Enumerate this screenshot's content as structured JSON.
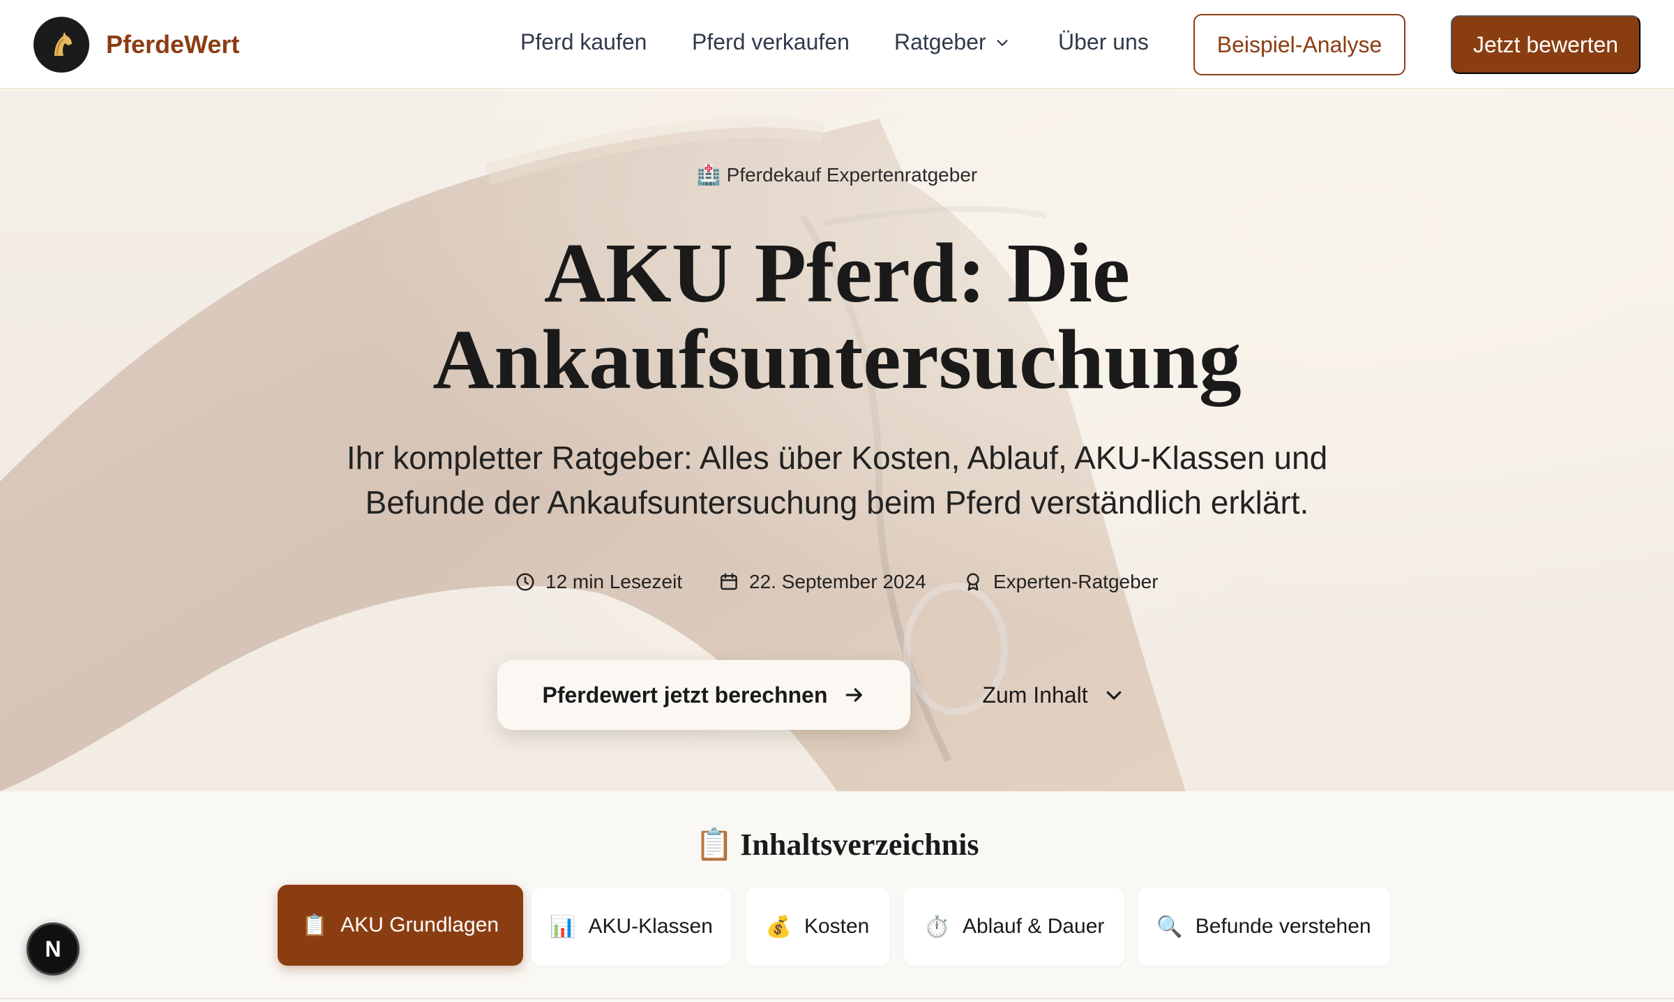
{
  "brand": {
    "name": "PferdeWert",
    "logo_icon": "horse-head-icon"
  },
  "nav": {
    "items": [
      {
        "label": "Pferd kaufen"
      },
      {
        "label": "Pferd verkaufen"
      },
      {
        "label": "Ratgeber",
        "has_dropdown": true
      },
      {
        "label": "Über uns"
      }
    ],
    "example_button": "Beispiel-Analyse",
    "cta_button": "Jetzt bewerten"
  },
  "hero": {
    "eyebrow_icon": "🏥",
    "eyebrow": "Pferdekauf Expertenratgeber",
    "title_line1": "AKU Pferd: Die",
    "title_line2": "Ankaufsuntersuchung",
    "subtitle_line1": "Ihr kompletter Ratgeber: Alles über Kosten, Ablauf, AKU-Klassen und",
    "subtitle_line2": "Befunde der Ankaufsuntersuchung beim Pferd verständlich erklärt.",
    "meta": {
      "reading_time": "12 min Lesezeit",
      "date": "22. September 2024",
      "badge": "Experten-Ratgeber"
    },
    "primary_cta": "Pferdewert jetzt berechnen",
    "secondary_cta": "Zum Inhalt"
  },
  "toc": {
    "title_icon": "📋",
    "title": "Inhaltsverzeichnis",
    "items": [
      {
        "icon": "📋",
        "label": "AKU Grundlagen",
        "active": true
      },
      {
        "icon": "📊",
        "label": "AKU-Klassen"
      },
      {
        "icon": "💰",
        "label": "Kosten"
      },
      {
        "icon": "⏱️",
        "label": "Ablauf & Dauer"
      },
      {
        "icon": "🔍",
        "label": "Befunde verstehen"
      }
    ]
  },
  "floating_badge": "N",
  "colors": {
    "brand": "#8b3d12",
    "text": "#1a1a1a",
    "nav_text": "#2f3a4a",
    "background": "#faf8f5"
  }
}
